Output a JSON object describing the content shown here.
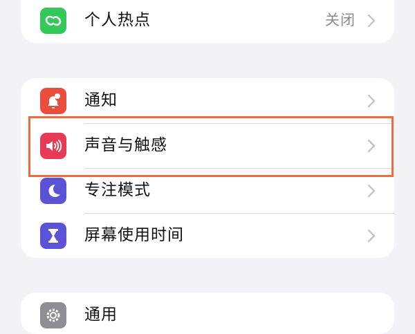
{
  "hotspot_row": {
    "label": "个人热点",
    "value": "关闭",
    "icon": "hotspot-chain-icon",
    "icon_color": "#34c759"
  },
  "notifications_row": {
    "label": "通知",
    "icon": "bell-badge-icon",
    "icon_color": "#eb4d3d"
  },
  "sounds_row": {
    "label": "声音与触感",
    "icon": "speaker-icon",
    "icon_color": "#e83a57"
  },
  "focus_row": {
    "label": "专注模式",
    "icon": "moon-icon",
    "icon_color": "#5b53d6"
  },
  "screentime_row": {
    "label": "屏幕使用时间",
    "icon": "hourglass-icon",
    "icon_color": "#5b53d6"
  },
  "general_row": {
    "label": "通用",
    "icon": "gear-icon",
    "icon_color": "#8e8e93"
  },
  "highlight_color": "#ef6a3c"
}
